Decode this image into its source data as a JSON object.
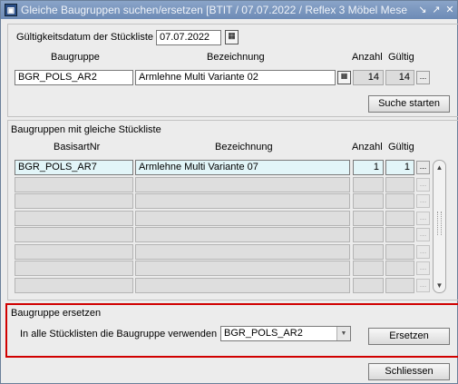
{
  "window": {
    "title": "Gleiche Baugruppen suchen/ersetzen  [BTIT / 07.07.2022 / Reflex 3 Möbel Mese",
    "icon_label": "▣"
  },
  "search": {
    "date_label": "Gültigkeitsdatum der Stückliste",
    "date_value": "07.07.2022",
    "col_baugruppe": "Baugruppe",
    "col_bezeichnung": "Bezeichnung",
    "col_anzahl": "Anzahl",
    "col_gueltig": "Gültig",
    "baugruppe": "BGR_POLS_AR2",
    "bezeichnung": "Armlehne Multi Variante 02",
    "anzahl": "14",
    "gueltig": "14",
    "more_label": "...",
    "start_button": "Suche starten"
  },
  "results": {
    "section_label": "Baugruppen mit gleiche Stückliste",
    "col_basisart": "BasisartNr",
    "col_bezeichnung": "Bezeichnung",
    "col_anzahl": "Anzahl",
    "col_gueltig": "Gültig",
    "rows": [
      {
        "basisart": "BGR_POLS_AR7",
        "bezeichnung": "Armlehne Multi Variante 07",
        "anzahl": "1",
        "gueltig": "1",
        "more": "..."
      },
      {
        "basisart": "",
        "bezeichnung": "",
        "anzahl": "",
        "gueltig": "",
        "more": "..."
      },
      {
        "basisart": "",
        "bezeichnung": "",
        "anzahl": "",
        "gueltig": "",
        "more": "..."
      },
      {
        "basisart": "",
        "bezeichnung": "",
        "anzahl": "",
        "gueltig": "",
        "more": "..."
      },
      {
        "basisart": "",
        "bezeichnung": "",
        "anzahl": "",
        "gueltig": "",
        "more": "..."
      },
      {
        "basisart": "",
        "bezeichnung": "",
        "anzahl": "",
        "gueltig": "",
        "more": "..."
      },
      {
        "basisart": "",
        "bezeichnung": "",
        "anzahl": "",
        "gueltig": "",
        "more": "..."
      }
    ]
  },
  "replace": {
    "section_label": "Baugruppe ersetzen",
    "use_label": "In alle Stücklisten die Baugruppe verwenden",
    "selected_value": "BGR_POLS_AR2",
    "replace_button": "Ersetzen"
  },
  "footer": {
    "close_button": "Schliessen"
  }
}
